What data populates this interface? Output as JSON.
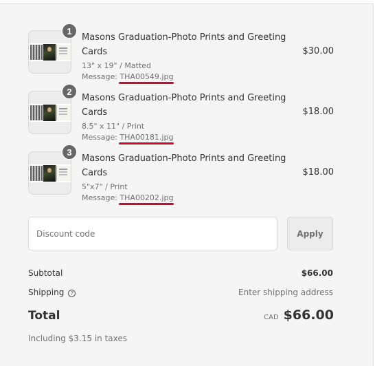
{
  "line_items": [
    {
      "quantity": "1",
      "title": "Masons Graduation-Photo Prints and Greeting Cards",
      "variant": "13\" x 19\" / Matted",
      "message_label": "Message: ",
      "message_file": "THA00549.jpg",
      "price": "$30.00"
    },
    {
      "quantity": "2",
      "title": "Masons Graduation-Photo Prints and Greeting Cards",
      "variant": "8.5\" x 11\" / Print",
      "message_label": "Message: ",
      "message_file": "THA00181.jpg",
      "price": "$18.00"
    },
    {
      "quantity": "3",
      "title": "Masons Graduation-Photo Prints and Greeting Cards",
      "variant": "5\"x7\" / Print",
      "message_label": "Message: ",
      "message_file": "THA00202.jpg",
      "price": "$18.00"
    }
  ],
  "discount": {
    "placeholder": "Discount code",
    "apply_label": "Apply"
  },
  "summary": {
    "subtotal_label": "Subtotal",
    "subtotal_value": "$66.00",
    "shipping_label": "Shipping",
    "shipping_help_icon": "?",
    "shipping_value": "Enter shipping address",
    "total_label": "Total",
    "currency": "CAD",
    "total_value": "$66.00",
    "taxes_note": "Including $3.15 in taxes"
  },
  "colors": {
    "annotation_underline": "#c8102e",
    "badge": "#666666",
    "panel_background": "#f5f5f5"
  }
}
